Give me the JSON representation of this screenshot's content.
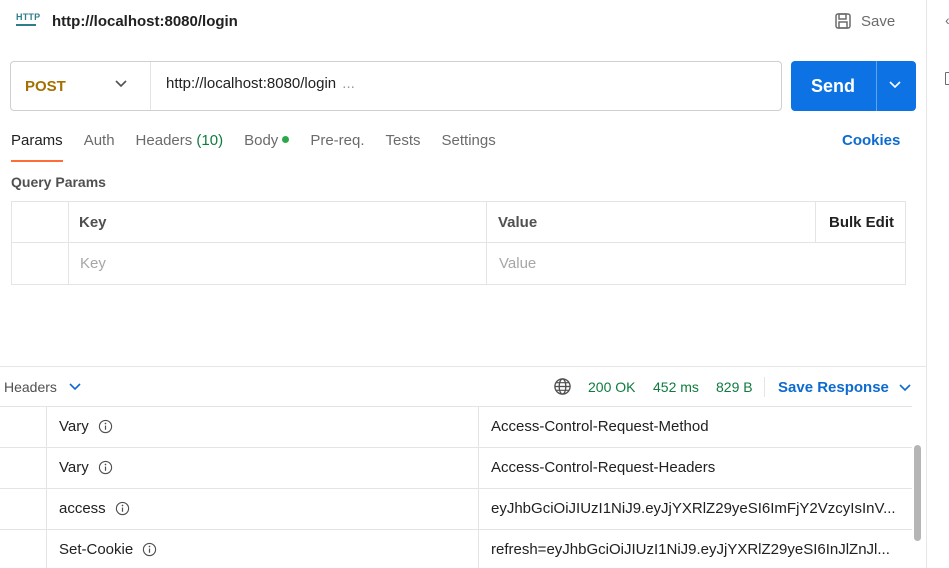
{
  "header": {
    "icon": "http-request-icon",
    "icon_text": "HTTP",
    "title": "http://localhost:8080/login",
    "save_label": "Save"
  },
  "request": {
    "method": "POST",
    "url": "http://localhost:8080/login",
    "url_suffix": "...",
    "send_label": "Send"
  },
  "tabs": [
    {
      "label": "Params",
      "active": true
    },
    {
      "label": "Auth"
    },
    {
      "label": "Headers",
      "count": "(10)"
    },
    {
      "label": "Body",
      "has_indicator": true
    },
    {
      "label": "Pre-req."
    },
    {
      "label": "Tests"
    },
    {
      "label": "Settings"
    }
  ],
  "cookies_label": "Cookies",
  "query_params": {
    "title": "Query Params",
    "columns": {
      "key": "Key",
      "value": "Value",
      "bulk_edit": "Bulk Edit"
    },
    "placeholders": {
      "key": "Key",
      "value": "Value"
    }
  },
  "response": {
    "view_label": "Headers",
    "status": "200 OK",
    "time": "452 ms",
    "size": "829 B",
    "save_response_label": "Save Response",
    "headers": [
      {
        "key": "Vary",
        "value": "Access-Control-Request-Method"
      },
      {
        "key": "Vary",
        "value": "Access-Control-Request-Headers"
      },
      {
        "key": "access",
        "value": "eyJhbGciOiJIUzI1NiJ9.eyJjYXRlZ29yeSI6ImFjY2VzcyIsInV..."
      },
      {
        "key": "Set-Cookie",
        "value": "refresh=eyJhbGciOiJIUzI1NiJ9.eyJjYXRlZ29yeSI6InJlZnJl..."
      }
    ]
  },
  "colors": {
    "accent": "#ff6c37",
    "primary": "#0d73e5",
    "method": "#a56f00",
    "success": "#0f7b3f"
  }
}
